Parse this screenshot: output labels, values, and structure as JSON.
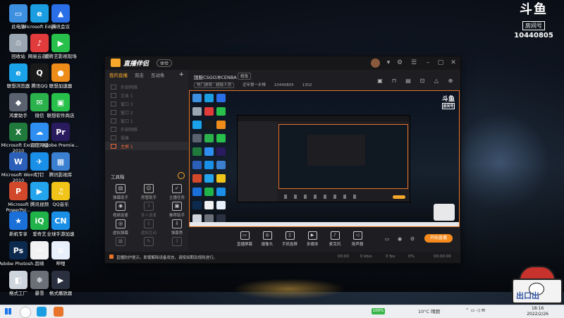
{
  "desktop_icons": [
    {
      "label": "此电脑",
      "color": "#3d8fe0",
      "glyph": "▭"
    },
    {
      "label": "Microsoft Edge",
      "color": "#1b9de2",
      "glyph": "e"
    },
    {
      "label": "腾讯会议",
      "color": "#2a6fe8",
      "glyph": "▲"
    },
    {
      "label": "回收站",
      "color": "#9aa6b2",
      "glyph": "♲"
    },
    {
      "label": "网易云音乐",
      "color": "#e23b3b",
      "glyph": "♪"
    },
    {
      "label": "爱奇艺影视现场",
      "color": "#27c04a",
      "glyph": "▶"
    },
    {
      "label": "联想浏览器",
      "color": "#1aa3e8",
      "glyph": "e"
    },
    {
      "label": "腾讯QQ",
      "color": "#1a1a1a",
      "glyph": "Q"
    },
    {
      "label": "联想加速器",
      "color": "#ee8c1a",
      "glyph": "●"
    },
    {
      "label": "鸿蒙助手",
      "color": "#5a6270",
      "glyph": "◆"
    },
    {
      "label": "微信",
      "color": "#2bb24c",
      "glyph": "✉"
    },
    {
      "label": "联想软件商店",
      "color": "#27c04a",
      "glyph": "▣"
    },
    {
      "label": "Microsoft Excel 2010",
      "color": "#1f7a3c",
      "glyph": "X"
    },
    {
      "label": "百度网盘",
      "color": "#2f8ff0",
      "glyph": "☁"
    },
    {
      "label": "Adobe Premie...",
      "color": "#2a1a5e",
      "glyph": "Pr"
    },
    {
      "label": "Microsoft Word 2010",
      "color": "#2b5fb8",
      "glyph": "W"
    },
    {
      "label": "钉钉",
      "color": "#1a8fe8",
      "glyph": "✈"
    },
    {
      "label": "腾讯影视库",
      "color": "#3a7fd0",
      "glyph": "▦"
    },
    {
      "label": "Microsoft PowerPoi...",
      "color": "#d2482a",
      "glyph": "P"
    },
    {
      "label": "腾讯视频",
      "color": "#24a4ec",
      "glyph": "▶"
    },
    {
      "label": "QQ音乐",
      "color": "#f0c418",
      "glyph": "♫"
    },
    {
      "label": "新机专享",
      "color": "#1a6fd8",
      "glyph": "★"
    },
    {
      "label": "爱奇艺",
      "color": "#1fb34a",
      "glyph": "iQ"
    },
    {
      "label": "全球手游加速",
      "color": "#1a8fe8",
      "glyph": "CN"
    },
    {
      "label": "Adobe Photosh...",
      "color": "#0b2a4e",
      "glyph": "Ps"
    },
    {
      "label": "剪映",
      "color": "#f2f2f2",
      "glyph": "✂"
    },
    {
      "label": "哔哩",
      "color": "#e8f0fb",
      "glyph": "≡"
    },
    {
      "label": "格式工厂",
      "color": "#cfd5dc",
      "glyph": "◧"
    },
    {
      "label": "暴雪",
      "color": "#6a6f78",
      "glyph": "❄"
    },
    {
      "label": "格式播放器",
      "color": "#2a3040",
      "glyph": "▶"
    }
  ],
  "brand": {
    "logo": "斗鱼",
    "sub": "房间号",
    "room_number": "10440805"
  },
  "app": {
    "name": "直播伴侣",
    "badge": "体验",
    "sidebar_tabs": [
      "我的直播",
      "双击",
      "互动条"
    ],
    "scenes": [
      "外部网络",
      "文本 1",
      "窗口 3",
      "窗口 2",
      "窗口 1",
      "外部网络",
      "摄像"
    ],
    "active_scene": "主屏 1",
    "tools_title": "工具箱",
    "tools": [
      {
        "label": "弹幕助手",
        "glyph": "▤"
      },
      {
        "label": "房管助手",
        "glyph": "☺"
      },
      {
        "label": "主播任务",
        "glyph": "✓"
      },
      {
        "label": "视频连麦",
        "glyph": "◉"
      },
      {
        "label": "多人连麦",
        "glyph": "⇩"
      },
      {
        "label": "推荐助手",
        "glyph": "▣"
      },
      {
        "label": "虚拟弹幕",
        "glyph": "◎"
      },
      {
        "label": "虚拟互动",
        "glyph": "⇩"
      },
      {
        "label": "弹幕秀",
        "glyph": "⇩"
      },
      {
        "label": "",
        "glyph": "▦"
      },
      {
        "label": "",
        "glyph": "✎"
      },
      {
        "label": "",
        "glyph": "⇩"
      }
    ],
    "room_title": "国服CSGO冲CENBA",
    "edit_label": "修改",
    "room_tag": "热门游戏 · 超级人员",
    "room_meta": [
      "近年第一步棒",
      "10440805",
      "1302"
    ],
    "controls": [
      {
        "label": "直播屏幕",
        "glyph": "▭"
      },
      {
        "label": "摄像头",
        "glyph": "◎"
      },
      {
        "label": "手机投屏",
        "glyph": "▯"
      },
      {
        "label": "多媒体",
        "glyph": "▶"
      },
      {
        "label": "麦克风",
        "glyph": "♪"
      },
      {
        "label": "扬声器",
        "glyph": "◁"
      }
    ],
    "start_label": "开始直播",
    "notice": "直播防护提示，即使解除设备状态，请按如期及规则进行。",
    "stats": [
      "00:00",
      "0 kb/s",
      "0 fps",
      "0%",
      "00:00:00"
    ]
  },
  "taskbar": {
    "battery": "100%",
    "weather": "10°C 晴朗",
    "time": "18:16",
    "date": "2022/2/26"
  },
  "mascot_text": "出口出"
}
